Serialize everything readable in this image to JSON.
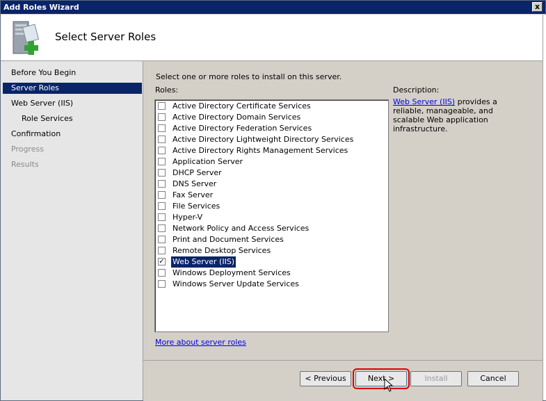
{
  "window": {
    "title": "Add Roles Wizard",
    "close_glyph": "x"
  },
  "header": {
    "title": "Select Server Roles",
    "icon": "server-roles-add-icon"
  },
  "nav": {
    "items": [
      {
        "label": "Before You Begin",
        "state": "normal"
      },
      {
        "label": "Server Roles",
        "state": "active"
      },
      {
        "label": "Web Server (IIS)",
        "state": "normal"
      },
      {
        "label": "Role Services",
        "state": "normal"
      },
      {
        "label": "Confirmation",
        "state": "normal"
      },
      {
        "label": "Progress",
        "state": "disabled"
      },
      {
        "label": "Results",
        "state": "disabled"
      }
    ]
  },
  "main": {
    "instruction": "Select one or more roles to install on this server.",
    "roles_label": "Roles:",
    "roles": [
      {
        "label": "Active Directory Certificate Services",
        "checked": false
      },
      {
        "label": "Active Directory Domain Services",
        "checked": false
      },
      {
        "label": "Active Directory Federation Services",
        "checked": false
      },
      {
        "label": "Active Directory Lightweight Directory Services",
        "checked": false
      },
      {
        "label": "Active Directory Rights Management Services",
        "checked": false
      },
      {
        "label": "Application Server",
        "checked": false
      },
      {
        "label": "DHCP Server",
        "checked": false
      },
      {
        "label": "DNS Server",
        "checked": false
      },
      {
        "label": "Fax Server",
        "checked": false
      },
      {
        "label": "File Services",
        "checked": false
      },
      {
        "label": "Hyper-V",
        "checked": false
      },
      {
        "label": "Network Policy and Access Services",
        "checked": false
      },
      {
        "label": "Print and Document Services",
        "checked": false
      },
      {
        "label": "Remote Desktop Services",
        "checked": false
      },
      {
        "label": "Web Server (IIS)",
        "checked": true
      },
      {
        "label": "Windows Deployment Services",
        "checked": false
      },
      {
        "label": "Windows Server Update Services",
        "checked": false
      }
    ],
    "check_glyph": "✓",
    "description_label": "Description:",
    "description_link": "Web Server (IIS)",
    "description_text": " provides a reliable, manageable, and scalable Web application infrastructure.",
    "more_link": "More about server roles"
  },
  "footer": {
    "previous": "< Previous",
    "next": "Next >",
    "install": "Install",
    "cancel": "Cancel"
  },
  "colors": {
    "title_bar": "#0a246a",
    "selection": "#0a246a",
    "link": "#0000ee",
    "focus_outline": "#e00000"
  }
}
